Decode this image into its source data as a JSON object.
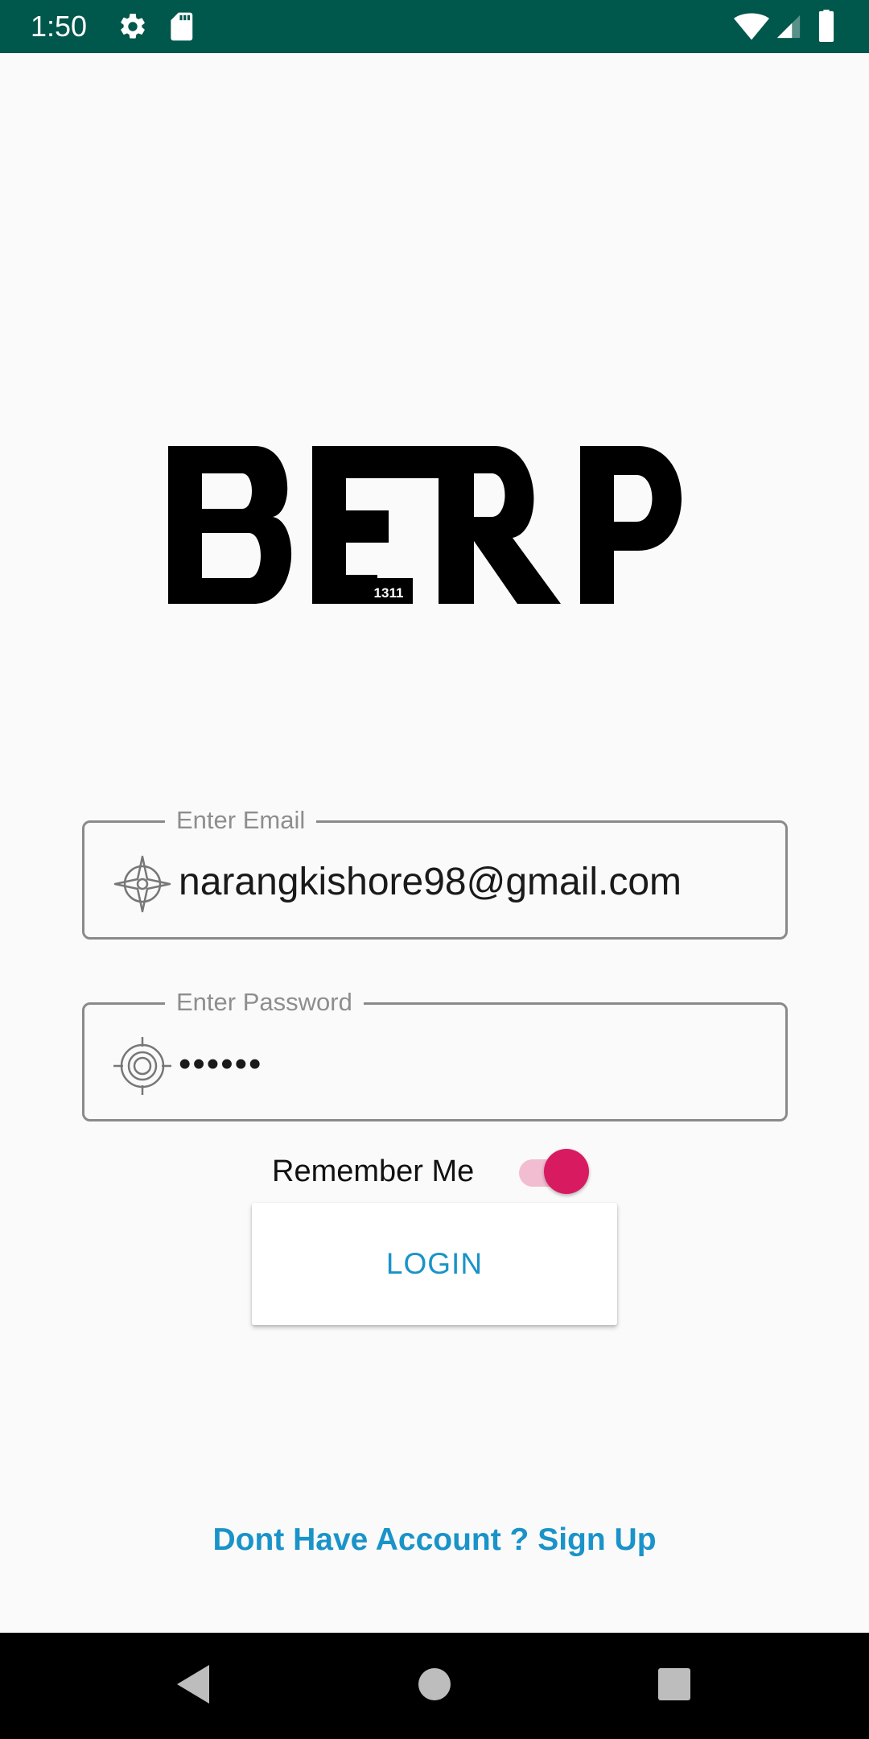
{
  "status_bar": {
    "time": "1:50",
    "icons": [
      "settings-icon",
      "sd-card-icon",
      "wifi-icon",
      "signal-icon",
      "battery-icon"
    ]
  },
  "logo": {
    "text": "BERP",
    "badge": "1311"
  },
  "email_field": {
    "label": "Enter Email",
    "value": "narangkishore98@gmail.com",
    "icon": "email-compass-icon"
  },
  "password_field": {
    "label": "Enter Password",
    "value": "••••••",
    "icon": "target-icon"
  },
  "remember": {
    "label": "Remember Me",
    "checked": true
  },
  "login_button": {
    "label": "LOGIN"
  },
  "signup_link": {
    "label": "Dont Have Account ? Sign Up"
  },
  "colors": {
    "status_bar": "#00574b",
    "accent": "#d81b60",
    "link": "#1a93c9"
  },
  "nav_bar": {
    "buttons": [
      "back-icon",
      "home-icon",
      "recents-icon"
    ]
  }
}
